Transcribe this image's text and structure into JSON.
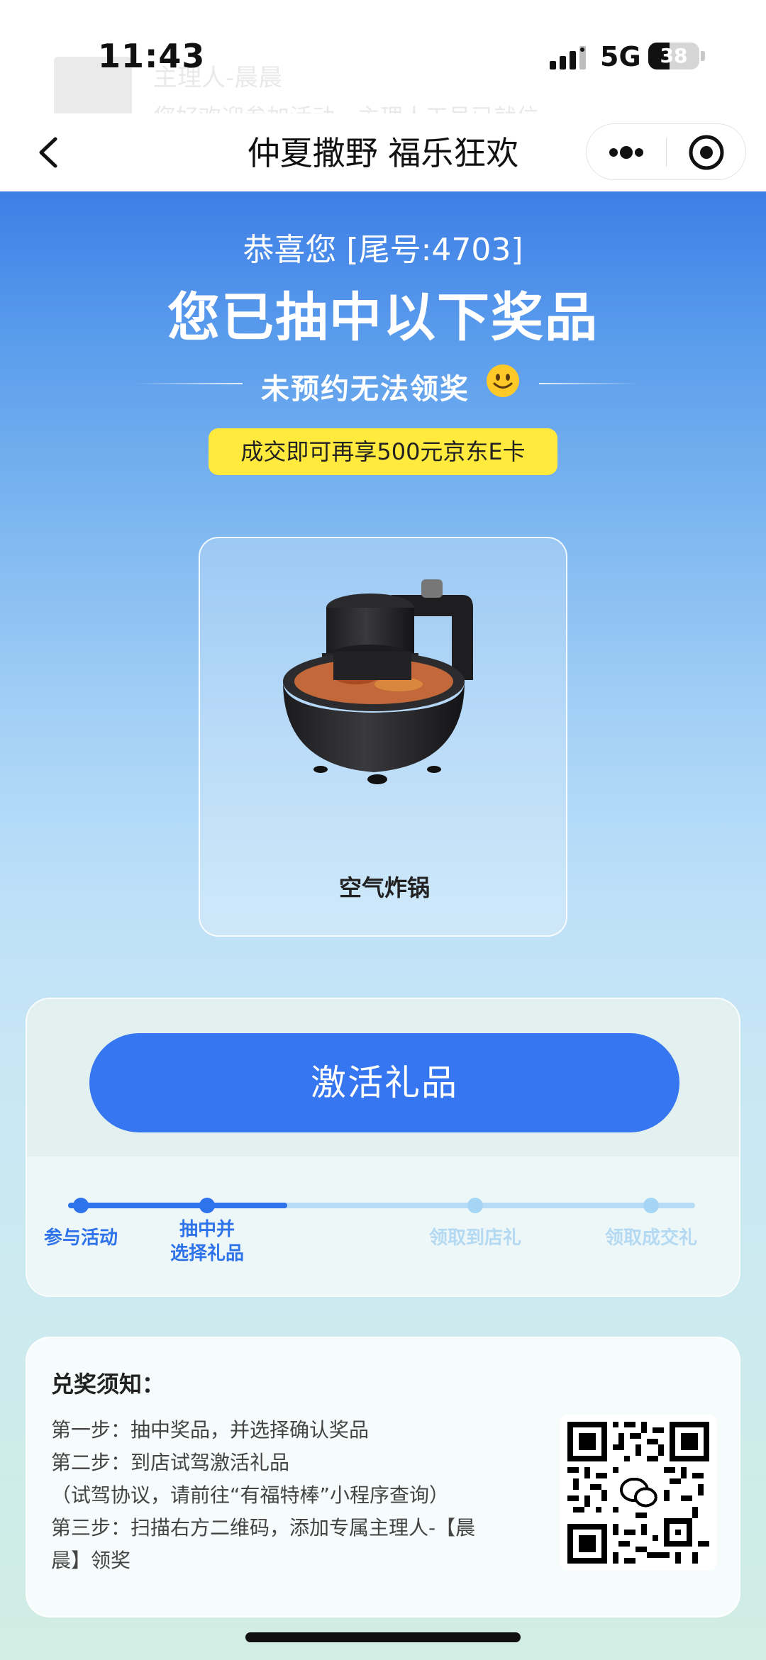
{
  "status_bar": {
    "time": "11:43",
    "network": "5G",
    "battery": "38"
  },
  "notification_ghost": {
    "title": "主理人-晨晨",
    "body": "您好欢迎参加活动，主理人工号已就位"
  },
  "nav": {
    "title": "仲夏撒野 福乐狂欢",
    "back_icon": "chevron-left-icon",
    "menu_icon": "more-dots-icon",
    "close_icon": "target-circle-icon"
  },
  "hero": {
    "congrats": "恭喜您 [尾号:4703]",
    "headline": "您已抽中以下奖品",
    "notice": "未预约无法领奖",
    "promo": "成交即可再享500元京东E卡"
  },
  "prize": {
    "name": "空气炸锅",
    "image_icon": "air-fryer-image"
  },
  "activation": {
    "button_label": "激活礼品",
    "progress": 0.35,
    "steps": [
      {
        "label_line1": "参与活动",
        "label_line2": "",
        "state": "done"
      },
      {
        "label_line1": "抽中并",
        "label_line2": "选择礼品",
        "state": "done"
      },
      {
        "label_line1": "领取到店礼",
        "label_line2": "",
        "state": "pending"
      },
      {
        "label_line1": "领取成交礼",
        "label_line2": "",
        "state": "pending"
      }
    ]
  },
  "rules": {
    "title": "兑奖须知：",
    "lines": [
      "第一步：抽中奖品，并选择确认奖品",
      "第二步：到店试驾激活礼品",
      "（试驾协议，请前往“有福特棒”小程序查询）",
      "第三步：扫描右方二维码，添加专属主理人-【晨",
      "晨】领奖"
    ],
    "qr_icon": "wechat-qr-code"
  },
  "colors": {
    "primary": "#3676f0",
    "promo_yellow": "#ffea3d",
    "inactive_step": "#b4d9f2"
  }
}
